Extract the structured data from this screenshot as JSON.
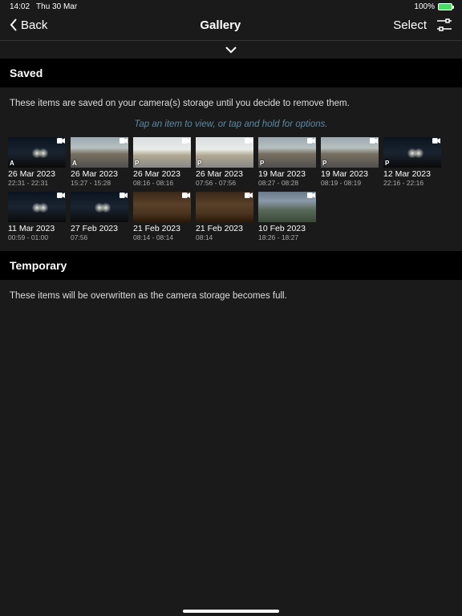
{
  "status": {
    "time": "14:02",
    "date": "Thu 30 Mar",
    "battery_pct": "100%"
  },
  "nav": {
    "back": "Back",
    "title": "Gallery",
    "select": "Select"
  },
  "saved": {
    "header": "Saved",
    "desc": "These items are saved on your camera(s) storage until you decide to remove them.",
    "hint": "Tap an item to view, or tap and hold for options.",
    "items": [
      {
        "date": "26 Mar 2023",
        "time": "22:31 - 22:31",
        "variant": "night",
        "type": "A"
      },
      {
        "date": "26 Mar 2023",
        "time": "15:27 - 15:28",
        "variant": "road",
        "type": "A"
      },
      {
        "date": "26 Mar 2023",
        "time": "08:16 - 08:16",
        "variant": "bright",
        "type": "P"
      },
      {
        "date": "26 Mar 2023",
        "time": "07:56 - 07:56",
        "variant": "bright",
        "type": "P"
      },
      {
        "date": "19 Mar 2023",
        "time": "08:27 - 08:28",
        "variant": "road",
        "type": "P"
      },
      {
        "date": "19 Mar 2023",
        "time": "08:19 - 08:19",
        "variant": "road",
        "type": "P"
      },
      {
        "date": "12 Mar 2023",
        "time": "22:16 - 22:16",
        "variant": "night",
        "type": "P"
      },
      {
        "date": "11 Mar 2023",
        "time": "00:59 - 01:00",
        "variant": "night",
        "type": ""
      },
      {
        "date": "27 Feb 2023",
        "time": "07:56",
        "variant": "night",
        "type": ""
      },
      {
        "date": "21 Feb 2023",
        "time": "08:14 - 08:14",
        "variant": "interior",
        "type": ""
      },
      {
        "date": "21 Feb 2023",
        "time": "08:14",
        "variant": "interior",
        "type": ""
      },
      {
        "date": "10 Feb 2023",
        "time": "18:26 - 18:27",
        "variant": "dusk",
        "type": ""
      }
    ]
  },
  "temporary": {
    "header": "Temporary",
    "desc": "These items will be overwritten as the camera storage becomes full."
  }
}
